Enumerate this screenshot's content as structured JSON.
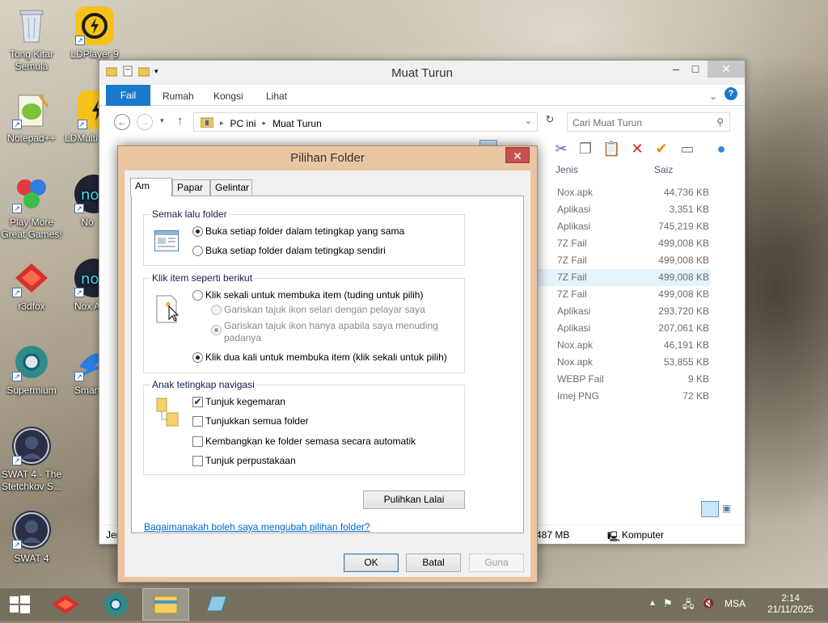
{
  "desktop": {
    "icons": [
      {
        "label": "Tong Kitar Semula"
      },
      {
        "label": "LDPlayer 9"
      },
      {
        "label": "Notepad++"
      },
      {
        "label": "LDMulti"
      },
      {
        "label": "Play More Great Games!"
      },
      {
        "label": "No"
      },
      {
        "label": "r3dfox"
      },
      {
        "label": "Nox A"
      },
      {
        "label": "Supermium"
      },
      {
        "label": "Smart"
      },
      {
        "label": "SWAT 4 - The Stetchkov S..."
      },
      {
        "label": "SWAT 4"
      }
    ]
  },
  "explorer": {
    "title": "Muat Turun",
    "ribbon_tabs": [
      "Fail",
      "Rumah",
      "Kongsi",
      "Lihat"
    ],
    "address": {
      "root": "PC ini",
      "folder": "Muat Turun"
    },
    "search_placeholder": "Cari Muat Turun",
    "columns": {
      "type": "Jenis",
      "size": "Saiz"
    },
    "files": [
      {
        "type": "Nox.apk",
        "size": "44,736 KB"
      },
      {
        "type": "Aplikasi",
        "size": "3,351 KB"
      },
      {
        "type": "Aplikasi",
        "size": "745,219 KB"
      },
      {
        "type": "7Z Fail",
        "size": "499,008 KB"
      },
      {
        "type": "7Z Fail",
        "size": "499,008 KB"
      },
      {
        "type": "7Z Fail",
        "size": "499,008 KB"
      },
      {
        "type": "7Z Fail",
        "size": "499,008 KB"
      },
      {
        "type": "Aplikasi",
        "size": "293,720 KB"
      },
      {
        "type": "Aplikasi",
        "size": "207,061 KB"
      },
      {
        "type": "Nox.apk",
        "size": "46,191 KB"
      },
      {
        "type": "Nox.apk",
        "size": "53,855 KB"
      },
      {
        "type": "WEBP Fail",
        "size": "9 KB"
      },
      {
        "type": "Imej PNG",
        "size": "72 KB"
      }
    ],
    "selected_row": 5,
    "status": {
      "left": "Jen",
      "size": "487 MB",
      "location": "Komputer"
    }
  },
  "dialog": {
    "title": "Pilihan Folder",
    "close_label": "✕",
    "tabs": [
      "Am",
      "Papar",
      "Gelintar"
    ],
    "browse_group": {
      "label": "Semak lalu folder",
      "options": [
        {
          "label": "Buka setiap folder dalam tetingkap yang sama",
          "checked": true
        },
        {
          "label": "Buka setiap folder dalam tetingkap sendiri",
          "checked": false
        }
      ]
    },
    "click_group": {
      "label": "Klik item seperti berikut",
      "single_click": "Klik sekali untuk membuka item (tuding untuk pilih)",
      "underline_all": "Gariskan tajuk ikon selari dengan pelayar saya",
      "underline_hover": "Gariskan tajuk ikon hanya apabila saya menuding padanya",
      "double_click": "Klik dua kali untuk membuka item (klik sekali untuk pilih)"
    },
    "nav_group": {
      "label": "Anak tetingkap navigasi",
      "options": [
        {
          "label": "Tunjuk kegemaran",
          "checked": true
        },
        {
          "label": "Tunjukkan semua folder",
          "checked": false
        },
        {
          "label": "Kembangkan ke folder semasa secara automatik",
          "checked": false
        },
        {
          "label": "Tunjuk perpustakaan",
          "checked": false
        }
      ]
    },
    "restore_defaults": "Pulihkan Lalai",
    "help_link": "Bagaimanakah boleh saya mengubah pilihan folder?",
    "buttons": {
      "ok": "OK",
      "cancel": "Batal",
      "apply": "Guna"
    }
  },
  "taskbar": {
    "language": "MSA",
    "time": "2:14",
    "date": "21/11/2025"
  }
}
